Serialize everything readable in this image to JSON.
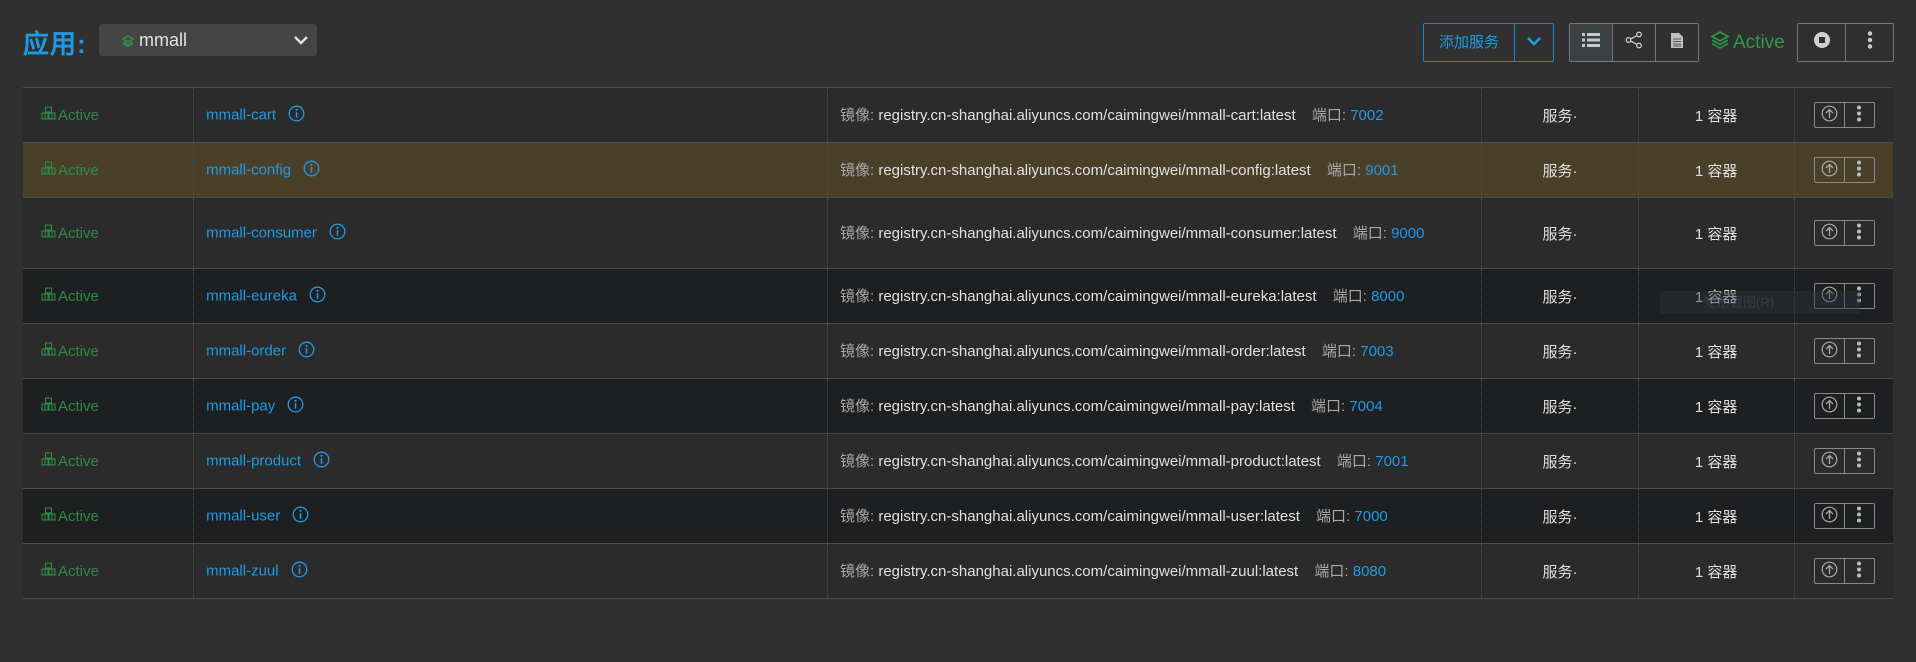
{
  "header": {
    "app_label": "应用:",
    "app_select_value": "mmall",
    "add_service_label": "添加服务",
    "stack_status": "Active",
    "view_buttons": [
      "list-view",
      "graph-view",
      "compose-file"
    ],
    "stack_actions": [
      "stop",
      "more"
    ]
  },
  "services": [
    {
      "status": "Active",
      "name": "mmall-cart",
      "image_label": "镜像:",
      "image": "registry.cn-shanghai.aliyuncs.com/caimingwei/mmall-cart:latest",
      "port_label": "端口:",
      "port": "7002",
      "type": "服务·",
      "containers": "1 容器"
    },
    {
      "status": "Active",
      "name": "mmall-config",
      "image_label": "镜像:",
      "image": "registry.cn-shanghai.aliyuncs.com/caimingwei/mmall-config:latest",
      "port_label": "端口:",
      "port": "9001",
      "type": "服务·",
      "containers": "1 容器"
    },
    {
      "status": "Active",
      "name": "mmall-consumer",
      "image_label": "镜像:",
      "image": "registry.cn-shanghai.aliyuncs.com/caimingwei/mmall-consumer:latest",
      "port_label": "端口:",
      "port": "9000",
      "type": "服务·",
      "containers": "1 容器"
    },
    {
      "status": "Active",
      "name": "mmall-eureka",
      "image_label": "镜像:",
      "image": "registry.cn-shanghai.aliyuncs.com/caimingwei/mmall-eureka:latest",
      "port_label": "端口:",
      "port": "8000",
      "type": "服务·",
      "containers": "1 容器"
    },
    {
      "status": "Active",
      "name": "mmall-order",
      "image_label": "镜像:",
      "image": "registry.cn-shanghai.aliyuncs.com/caimingwei/mmall-order:latest",
      "port_label": "端口:",
      "port": "7003",
      "type": "服务·",
      "containers": "1 容器"
    },
    {
      "status": "Active",
      "name": "mmall-pay",
      "image_label": "镜像:",
      "image": "registry.cn-shanghai.aliyuncs.com/caimingwei/mmall-pay:latest",
      "port_label": "端口:",
      "port": "7004",
      "type": "服务·",
      "containers": "1 容器"
    },
    {
      "status": "Active",
      "name": "mmall-product",
      "image_label": "镜像:",
      "image": "registry.cn-shanghai.aliyuncs.com/caimingwei/mmall-product:latest",
      "port_label": "端口:",
      "port": "7001",
      "type": "服务·",
      "containers": "1 容器"
    },
    {
      "status": "Active",
      "name": "mmall-user",
      "image_label": "镜像:",
      "image": "registry.cn-shanghai.aliyuncs.com/caimingwei/mmall-user:latest",
      "port_label": "端口:",
      "port": "7000",
      "type": "服务·",
      "containers": "1 容器"
    },
    {
      "status": "Active",
      "name": "mmall-zuul",
      "image_label": "镜像:",
      "image": "registry.cn-shanghai.aliyuncs.com/caimingwei/mmall-zuul:latest",
      "port_label": "端口:",
      "port": "8080",
      "type": "服务·",
      "containers": "1 容器"
    }
  ],
  "overlay_tooltip": "矩形截图(R)",
  "colors": {
    "accent": "#1e9be6",
    "active": "#2f9a48",
    "highlight_row": "#4a4029"
  }
}
